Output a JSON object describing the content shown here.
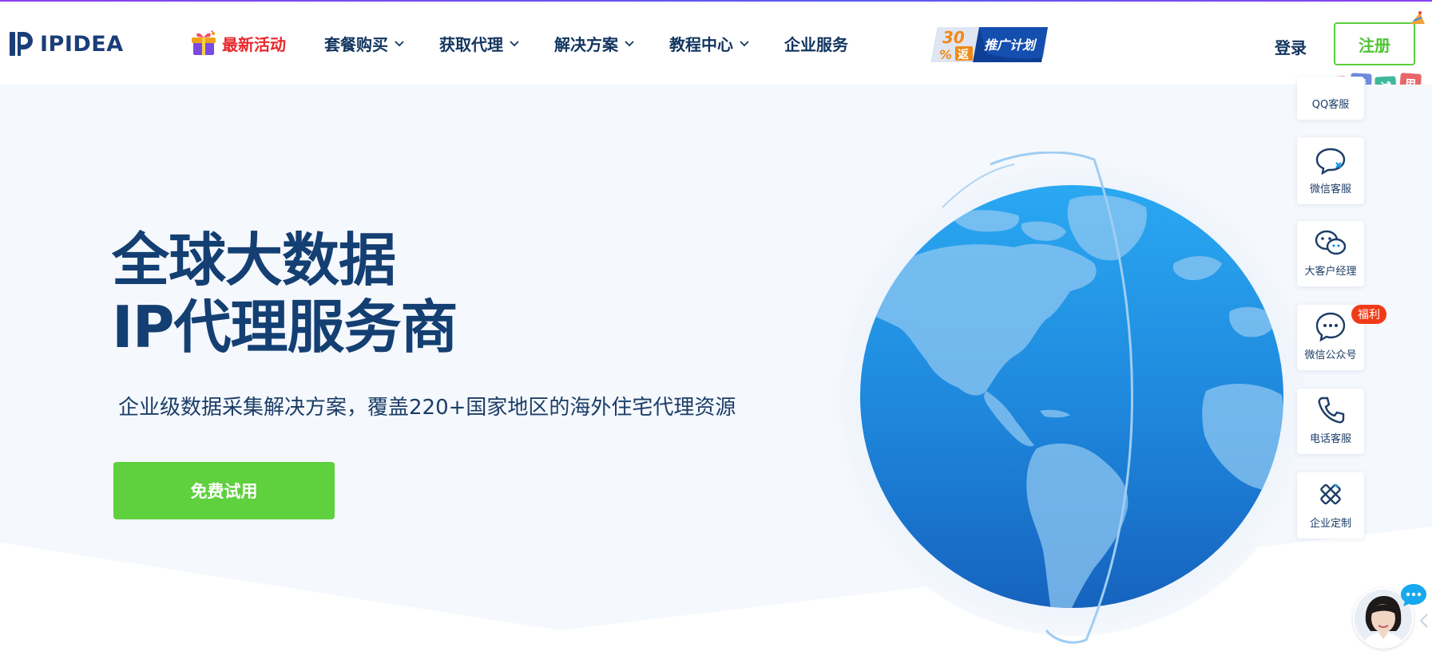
{
  "brand": {
    "name": "IPIDEA"
  },
  "nav": {
    "promo_label": "最新活动",
    "items": [
      {
        "label": "套餐购买",
        "dropdown": true
      },
      {
        "label": "获取代理",
        "dropdown": true
      },
      {
        "label": "解决方案",
        "dropdown": true
      },
      {
        "label": "教程中心",
        "dropdown": true
      },
      {
        "label": "企业服务",
        "dropdown": false
      }
    ],
    "promo_badge": {
      "percent": "30",
      "percent_sign": "%",
      "rebate": "返",
      "label": "推广计划"
    },
    "login_label": "登录",
    "register_label": "注册",
    "trial_tags": [
      "免",
      "费",
      "试",
      "用"
    ]
  },
  "hero": {
    "title_line1": "全球大数据",
    "title_line2": "IP代理服务商",
    "subtitle": "企业级数据采集解决方案，覆盖220+国家地区的海外住宅代理资源",
    "cta_label": "免费试用"
  },
  "side_panel": {
    "items": [
      {
        "label": "QQ客服",
        "icon": "qq-icon"
      },
      {
        "label": "微信客服",
        "icon": "wechat-service-icon"
      },
      {
        "label": "大客户经理",
        "icon": "wechat-icon"
      },
      {
        "label": "微信公众号",
        "icon": "chat-bubble-icon",
        "badge": "福利"
      },
      {
        "label": "电话客服",
        "icon": "phone-icon"
      },
      {
        "label": "企业定制",
        "icon": "tools-icon"
      }
    ]
  },
  "colors": {
    "brand_dark": "#143f72",
    "accent_green": "#5fd03e",
    "promo_red": "#e8282d",
    "badge_red": "#f03a17",
    "globe_blue": "#1e7fd8"
  }
}
